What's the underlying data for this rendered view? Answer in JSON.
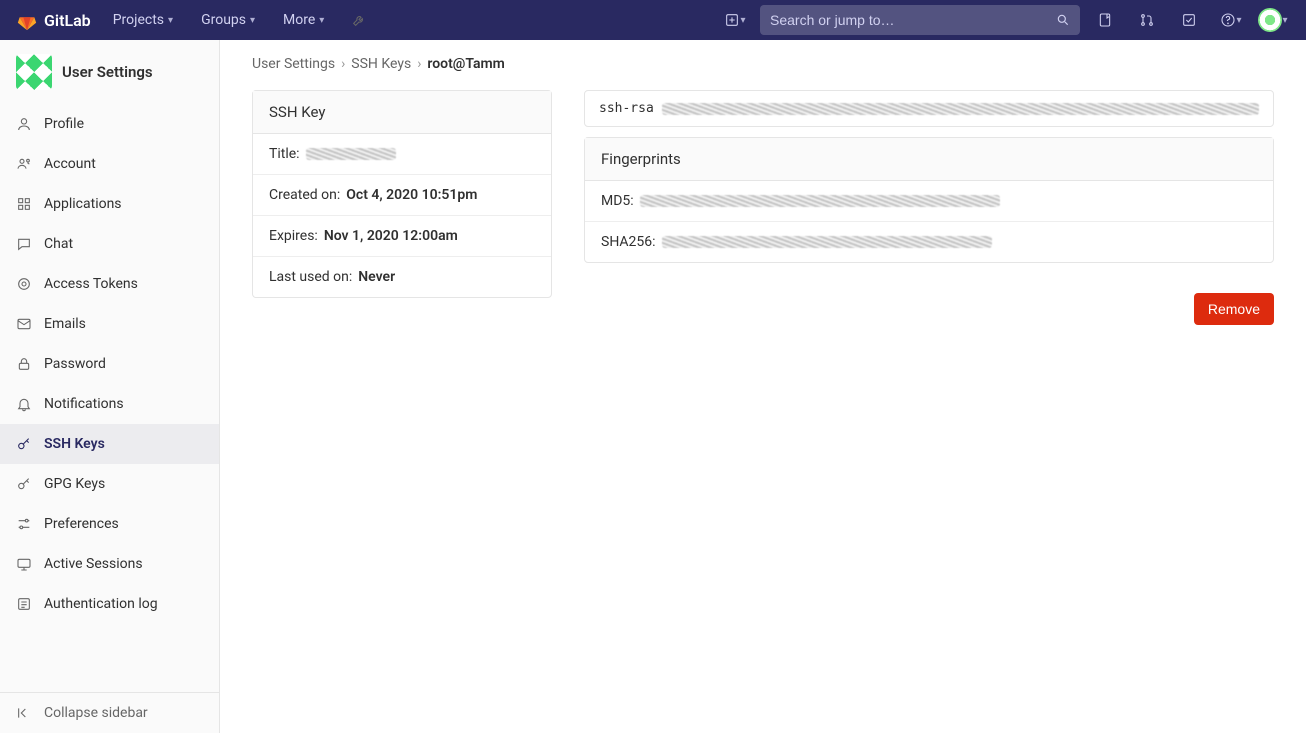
{
  "brand": "GitLab",
  "topnav": {
    "projects": "Projects",
    "groups": "Groups",
    "more": "More",
    "search_placeholder": "Search or jump to…"
  },
  "sidebar": {
    "title": "User Settings",
    "items": [
      {
        "label": "Profile"
      },
      {
        "label": "Account"
      },
      {
        "label": "Applications"
      },
      {
        "label": "Chat"
      },
      {
        "label": "Access Tokens"
      },
      {
        "label": "Emails"
      },
      {
        "label": "Password"
      },
      {
        "label": "Notifications"
      },
      {
        "label": "SSH Keys"
      },
      {
        "label": "GPG Keys"
      },
      {
        "label": "Preferences"
      },
      {
        "label": "Active Sessions"
      },
      {
        "label": "Authentication log"
      }
    ],
    "collapse": "Collapse sidebar"
  },
  "crumbs": {
    "a": "User Settings",
    "b": "SSH Keys",
    "c": "root@Tamm"
  },
  "ssh": {
    "header": "SSH Key",
    "title_label": "Title:",
    "created_label": "Created on:",
    "created_value": "Oct 4, 2020 10:51pm",
    "expires_label": "Expires:",
    "expires_value": "Nov 1, 2020 12:00am",
    "lastused_label": "Last used on:",
    "lastused_value": "Never",
    "key_prefix": "ssh-rsa",
    "fp_header": "Fingerprints",
    "md5_label": "MD5:",
    "sha_label": "SHA256:",
    "remove": "Remove"
  }
}
